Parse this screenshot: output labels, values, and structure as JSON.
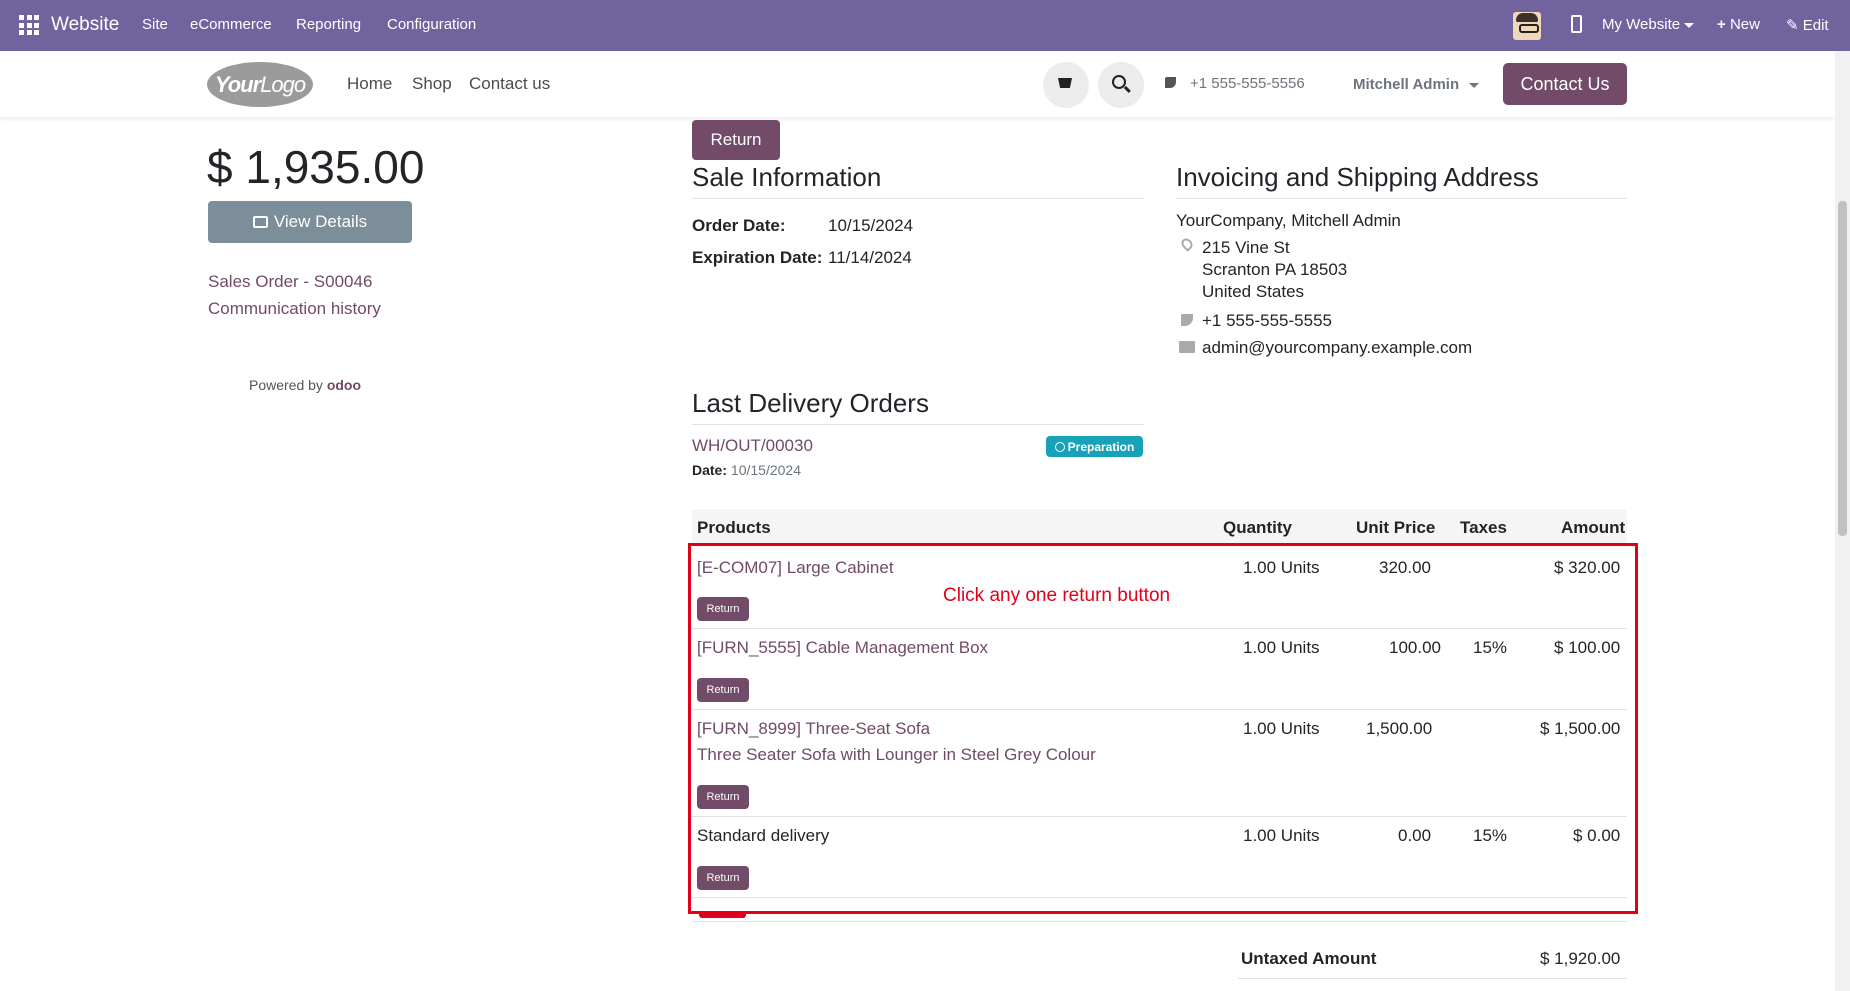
{
  "topbar": {
    "brand": "Website",
    "menu": [
      "Site",
      "eCommerce",
      "Reporting",
      "Configuration"
    ],
    "website_selector": "My Website",
    "new_label": "New",
    "edit_label": "Edit",
    "bg_color": "#71639e"
  },
  "navbar": {
    "logo_bold": "Your",
    "logo_light": "Logo",
    "links": [
      "Home",
      "Shop",
      "Contact us"
    ],
    "phone": "+1 555-555-5556",
    "user": "Mitchell Admin",
    "contact_button": "Contact Us"
  },
  "sidebar": {
    "total": "$ 1,935.00",
    "view_details": "View Details",
    "sales_order_link": "Sales Order - S00046",
    "history_link": "Communication history",
    "powered_by": "Powered by",
    "powered_brand": "odoo"
  },
  "main": {
    "return_button": "Return",
    "sale_info": {
      "heading": "Sale Information",
      "order_date_label": "Order Date:",
      "order_date": "10/15/2024",
      "expiration_label": "Expiration Date:",
      "expiration_date": "11/14/2024"
    },
    "address": {
      "heading": "Invoicing and Shipping Address",
      "name": "YourCompany, Mitchell Admin",
      "street": "215 Vine St",
      "city": "Scranton PA 18503",
      "country": "United States",
      "phone": "+1 555-555-5555",
      "email": "admin@yourcompany.example.com"
    },
    "delivery": {
      "heading": "Last Delivery Orders",
      "ref": "WH/OUT/00030",
      "status": "Preparation",
      "date_label": "Date:",
      "date": "10/15/2024"
    },
    "table": {
      "headers": [
        "Products",
        "Quantity",
        "Unit Price",
        "Taxes",
        "Amount"
      ],
      "rows": [
        {
          "product": "[E-COM07] Large Cabinet",
          "desc": "",
          "qty": "1.00 Units",
          "price": "320.00",
          "taxes": "",
          "amount": "$ 320.00",
          "return": "Return"
        },
        {
          "product": "[FURN_5555] Cable Management Box",
          "desc": "",
          "qty": "1.00 Units",
          "price": "100.00",
          "taxes": "15%",
          "amount": "$ 100.00",
          "return": "Return"
        },
        {
          "product": "[FURN_8999] Three-Seat Sofa",
          "desc": "Three Seater Sofa with Lounger in Steel Grey Colour",
          "qty": "1.00 Units",
          "price": "1,500.00",
          "taxes": "",
          "amount": "$ 1,500.00",
          "return": "Return"
        },
        {
          "product": "Standard delivery",
          "desc": "",
          "qty": "1.00 Units",
          "price": "0.00",
          "taxes": "15%",
          "amount": "$ 0.00",
          "return": "Return"
        }
      ]
    },
    "annotation": "Click any one return button",
    "untaxed_label": "Untaxed Amount",
    "untaxed_value": "$ 1,920.00"
  }
}
